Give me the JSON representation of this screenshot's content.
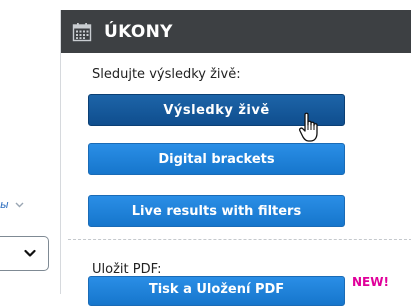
{
  "left_fragment": {
    "partial_label": "ы",
    "chevron_icon": "chevron-down-icon",
    "select_chevron_icon": "chevron-down-icon"
  },
  "panel": {
    "title": "ÚKONY",
    "header_icon": "calendar-icon",
    "live_section_label": "Sledujte výsledky živě:",
    "buttons": {
      "live_results": "Výsledky živě",
      "digital_brackets": "Digital brackets",
      "live_results_filters": "Live results with filters",
      "print_save_pdf": "Tisk a Uložení PDF"
    },
    "pdf_section_label": "Uložit PDF:",
    "new_badge": "NEW!"
  },
  "colors": {
    "header_bg": "#3d4043",
    "button_dark": "#0f4e8e",
    "button_blue": "#1676cc",
    "new_badge": "#e0009a"
  },
  "cursor_icon": "hand-pointer-icon"
}
